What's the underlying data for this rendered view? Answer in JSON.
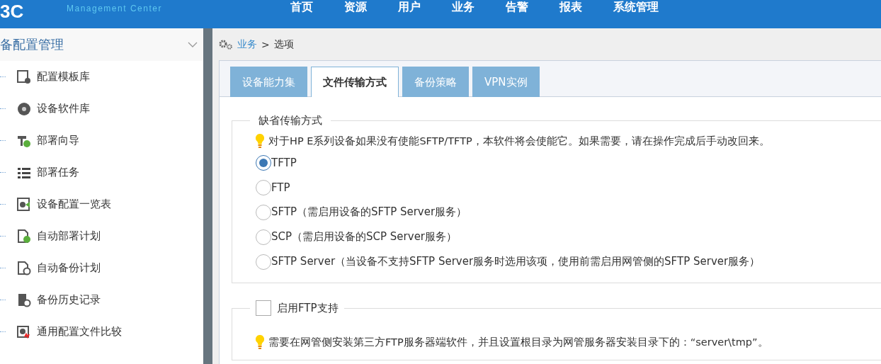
{
  "header": {
    "logo": "3C",
    "product_line2": "Management Center",
    "nav": [
      {
        "label": "首页",
        "selected": false
      },
      {
        "label": "资源",
        "selected": false
      },
      {
        "label": "用户",
        "selected": false
      },
      {
        "label": "业务",
        "selected": false
      },
      {
        "label": "告警",
        "selected": false
      },
      {
        "label": "报表",
        "selected": false
      },
      {
        "label": "系统管理",
        "selected": false
      }
    ]
  },
  "sidebar": {
    "title": "备配置管理",
    "expanded": true,
    "items": [
      {
        "label": "配置模板库"
      },
      {
        "label": "设备软件库"
      },
      {
        "label": "部署向导"
      },
      {
        "label": "部署任务"
      },
      {
        "label": "设备配置一览表"
      },
      {
        "label": "自动部署计划"
      },
      {
        "label": "自动备份计划"
      },
      {
        "label": "备份历史记录"
      },
      {
        "label": "通用配置文件比较"
      }
    ]
  },
  "breadcrumb": {
    "link": "业务",
    "separator": ">",
    "current": "选项"
  },
  "tabs": [
    {
      "label": "设备能力集",
      "selected": false
    },
    {
      "label": "文件传输方式",
      "selected": true
    },
    {
      "label": "备份策略",
      "selected": false
    },
    {
      "label": "VPN实例",
      "selected": false
    }
  ],
  "default_transfer": {
    "legend": "缺省传输方式",
    "hint": "对于HP E系列设备如果没有使能SFTP/TFTP，本软件将会使能它。如果需要，请在操作完成后手动改回来。",
    "options": [
      {
        "label": "TFTP",
        "selected": true
      },
      {
        "label": "FTP",
        "selected": false
      },
      {
        "label": "SFTP（需启用设备的SFTP Server服务）",
        "selected": false
      },
      {
        "label": "SCP（需启用设备的SCP Server服务）",
        "selected": false
      },
      {
        "label": "SFTP Server（当设备不支持SFTP Server服务时选用该项，使用前需启用网管侧的SFTP Server服务）",
        "selected": false
      }
    ]
  },
  "ftp_support": {
    "label": "启用FTP支持",
    "checked": false,
    "hint": "需要在网管侧安装第三方FTP服务器端软件，并且设置根目录为网管服务器安装目录下的：“server\\tmp”。"
  }
}
